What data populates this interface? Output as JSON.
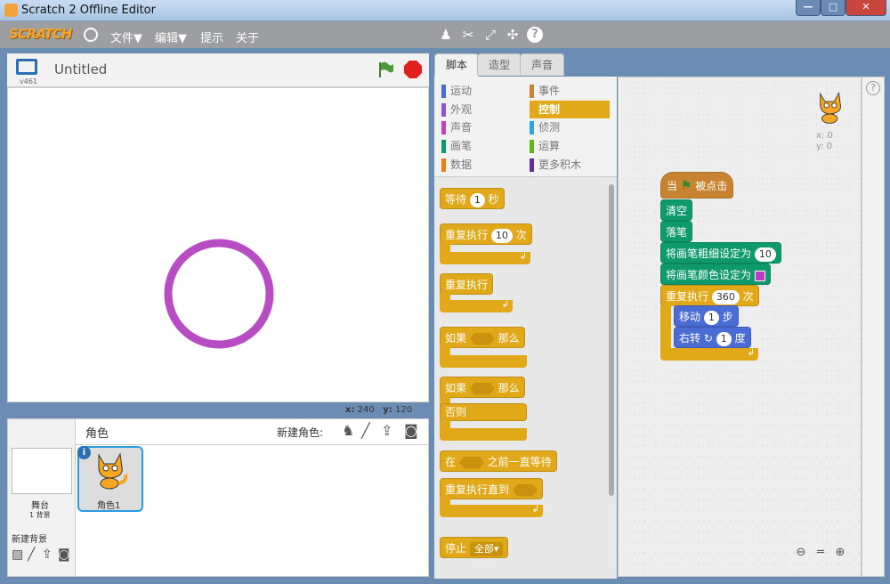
{
  "window": {
    "title": "Scratch 2 Offline Editor",
    "min": "—",
    "max": "□",
    "close": "✕"
  },
  "menubar": {
    "logo": "SCRATCH",
    "file": "文件▼",
    "edit": "编辑▼",
    "tips": "提示",
    "about": "关于"
  },
  "stage": {
    "version": "v461",
    "project_name": "Untitled",
    "coord_x_label": "x:",
    "coord_x": "240",
    "coord_y_label": "y:",
    "coord_y": "120"
  },
  "sprites": {
    "header": "角色",
    "new_sprite": "新建角色:",
    "stage_label": "舞台",
    "stage_backdrops": "1 背景",
    "new_backdrop": "新建背景",
    "sprite1_name": "角色1"
  },
  "tabs": [
    "脚本",
    "造型",
    "声音"
  ],
  "categories": {
    "left": [
      "运动",
      "外观",
      "声音",
      "画笔",
      "数据"
    ],
    "right": [
      "事件",
      "控制",
      "侦测",
      "运算",
      "更多积木"
    ],
    "left_colors": [
      "#4a6cd4",
      "#8a55d7",
      "#bb42c3",
      "#0e9a6c",
      "#ee7d16"
    ],
    "right_colors": [
      "#c88330",
      "#e1a91a",
      "#2ca5e2",
      "#5cb712",
      "#632d99"
    ],
    "active": "控制"
  },
  "palette": {
    "wait": "等待",
    "wait_val": "1",
    "wait_unit": "秒",
    "repeat": "重复执行",
    "repeat_val": "10",
    "repeat_unit": "次",
    "forever": "重复执行",
    "if": "如果",
    "then": "那么",
    "if2": "如果",
    "then2": "那么",
    "else": "否则",
    "wait_until_pre": "在",
    "wait_until_post": "之前一直等待",
    "repeat_until": "重复执行直到",
    "stop": "停止",
    "stop_val": "全部▾"
  },
  "script": {
    "hat_pre": "当",
    "hat_post": "被点击",
    "clear": "清空",
    "pen_down": "落笔",
    "set_size": "将画笔粗细设定为",
    "set_size_val": "10",
    "set_color": "将画笔颜色设定为",
    "pen_color": "#bb39c4",
    "repeat": "重复执行",
    "repeat_val": "360",
    "repeat_unit": "次",
    "move": "移动",
    "move_val": "1",
    "move_unit": "步",
    "turn": "右转",
    "turn_val": "1",
    "turn_unit": "度",
    "sprite_x": "x: 0",
    "sprite_y": "y: 0"
  },
  "help_icon": "?",
  "circle_color": "#b84cc2"
}
